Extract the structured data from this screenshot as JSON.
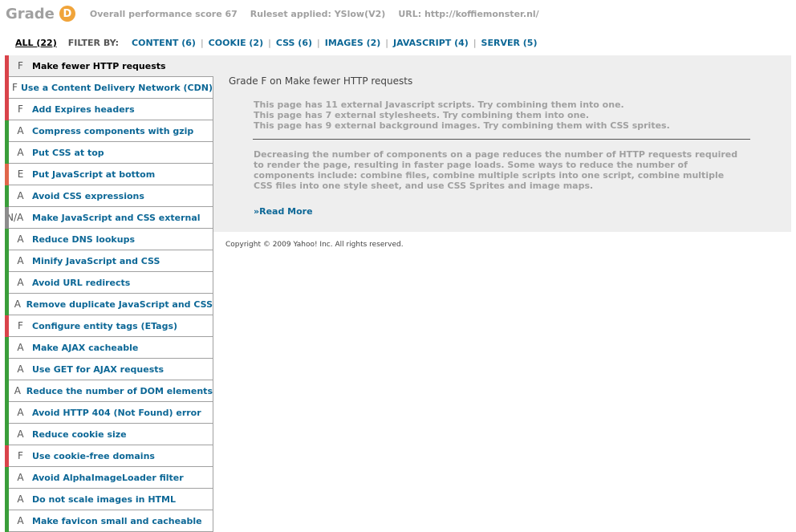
{
  "header": {
    "grade_label": "Grade",
    "grade_value": "D",
    "overall_score": "Overall performance score 67",
    "ruleset": "Ruleset applied: YSlow(V2)",
    "url": "URL: http://koffiemonster.nl/"
  },
  "filters": {
    "all": "ALL (22)",
    "filter_by": "FILTER BY:",
    "items": [
      {
        "label": "CONTENT (6)"
      },
      {
        "label": "COOKIE (2)"
      },
      {
        "label": "CSS (6)"
      },
      {
        "label": "IMAGES (2)"
      },
      {
        "label": "JAVASCRIPT (4)"
      },
      {
        "label": "SERVER (5)"
      }
    ],
    "separator": "|"
  },
  "grade_colors": {
    "A": "#3a9e3a",
    "E": "#e0664a",
    "F": "#d9434a",
    "N/A": "#8c8c8c"
  },
  "rules": [
    {
      "grade": "F",
      "title": "Make fewer HTTP requests",
      "selected": true
    },
    {
      "grade": "F",
      "title": "Use a Content Delivery Network (CDN)"
    },
    {
      "grade": "F",
      "title": "Add Expires headers"
    },
    {
      "grade": "A",
      "title": "Compress components with gzip"
    },
    {
      "grade": "A",
      "title": "Put CSS at top"
    },
    {
      "grade": "E",
      "title": "Put JavaScript at bottom"
    },
    {
      "grade": "A",
      "title": "Avoid CSS expressions"
    },
    {
      "grade": "N/A",
      "title": "Make JavaScript and CSS external"
    },
    {
      "grade": "A",
      "title": "Reduce DNS lookups"
    },
    {
      "grade": "A",
      "title": "Minify JavaScript and CSS"
    },
    {
      "grade": "A",
      "title": "Avoid URL redirects"
    },
    {
      "grade": "A",
      "title": "Remove duplicate JavaScript and CSS"
    },
    {
      "grade": "F",
      "title": "Configure entity tags (ETags)"
    },
    {
      "grade": "A",
      "title": "Make AJAX cacheable"
    },
    {
      "grade": "A",
      "title": "Use GET for AJAX requests"
    },
    {
      "grade": "A",
      "title": "Reduce the number of DOM elements"
    },
    {
      "grade": "A",
      "title": "Avoid HTTP 404 (Not Found) error"
    },
    {
      "grade": "A",
      "title": "Reduce cookie size"
    },
    {
      "grade": "F",
      "title": "Use cookie-free domains"
    },
    {
      "grade": "A",
      "title": "Avoid AlphaImageLoader filter"
    },
    {
      "grade": "A",
      "title": "Do not scale images in HTML"
    },
    {
      "grade": "A",
      "title": "Make favicon small and cacheable"
    }
  ],
  "detail": {
    "title": "Grade F on Make fewer HTTP requests",
    "findings": [
      "This page has 11 external Javascript scripts. Try combining them into one.",
      "This page has 7 external stylesheets. Try combining them into one.",
      "This page has 9 external background images. Try combining them with CSS sprites."
    ],
    "description": "Decreasing the number of components on a page reduces the number of HTTP requests required to render the page, resulting in faster page loads. Some ways to reduce the number of components include: combine files, combine multiple scripts into one script, combine multiple CSS files into one style sheet, and use CSS Sprites and image maps.",
    "read_more": "»Read More"
  },
  "footer": {
    "copyright": "Copyright © 2009 Yahoo! Inc. All rights reserved."
  }
}
